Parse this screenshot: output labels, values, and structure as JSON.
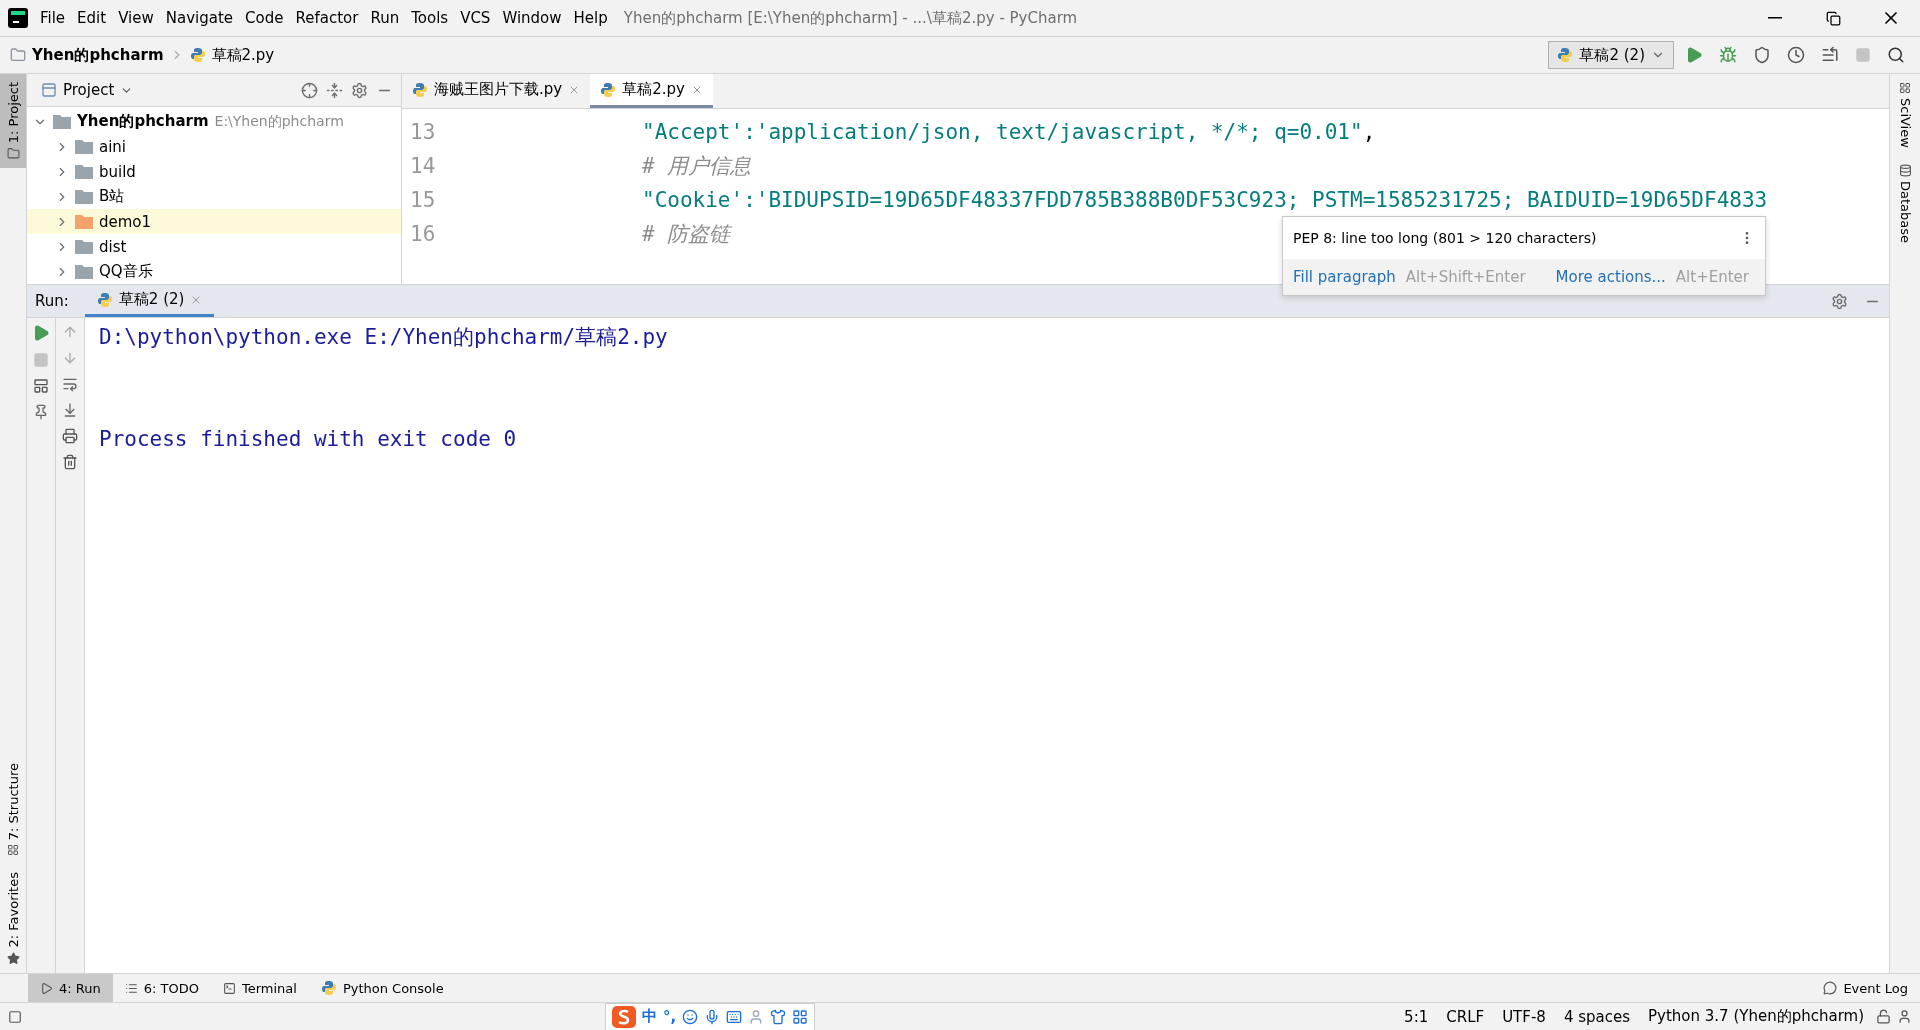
{
  "window": {
    "title": "Yhen的phcharm [E:\\Yhen的phcharm] - ...\\草稿2.py - PyCharm"
  },
  "menu": [
    "File",
    "Edit",
    "View",
    "Navigate",
    "Code",
    "Refactor",
    "Run",
    "Tools",
    "VCS",
    "Window",
    "Help"
  ],
  "breadcrumb": [
    "Yhen的phcharm",
    "草稿2.py"
  ],
  "run_config": {
    "label": "草稿2 (2)"
  },
  "left_stripe": [
    "1: Project",
    "7: Structure",
    "2: Favorites"
  ],
  "right_stripe": [
    "SciView",
    "Database"
  ],
  "project": {
    "title": "Project",
    "tree": [
      {
        "name": "Yhen的phcharm",
        "path": "E:\\Yhen的phcharm",
        "expanded": true,
        "selected": false,
        "color": "#9aa4ad",
        "children": [
          {
            "name": "aini",
            "expanded": false,
            "selected": false,
            "color": "#9aa4ad"
          },
          {
            "name": "build",
            "expanded": false,
            "selected": false,
            "color": "#9aa4ad"
          },
          {
            "name": "B站",
            "expanded": false,
            "selected": false,
            "color": "#9aa4ad"
          },
          {
            "name": "demo1",
            "expanded": false,
            "selected": true,
            "color": "#f4a26b"
          },
          {
            "name": "dist",
            "expanded": false,
            "selected": false,
            "color": "#9aa4ad"
          },
          {
            "name": "QQ音乐",
            "expanded": false,
            "selected": false,
            "color": "#9aa4ad"
          }
        ]
      }
    ]
  },
  "editor": {
    "tabs": [
      {
        "label": "海贼王图片下载.py",
        "selected": false
      },
      {
        "label": "草稿2.py",
        "selected": true
      }
    ],
    "lines": [
      {
        "number": "13",
        "parts": [
          {
            "kind": "string",
            "text": "\"Accept':'application/json, text/javascript, */*; q=0.01\""
          },
          {
            "kind": "plain",
            "text": ","
          }
        ]
      },
      {
        "number": "14",
        "parts": [
          {
            "kind": "comment",
            "text": "# 用户信息"
          }
        ]
      },
      {
        "number": "15",
        "parts": [
          {
            "kind": "string",
            "text": "\"Cookie':'BIDUPSID=19D65DF48337FDD785B388B0DF53C923; PSTM=1585231725; BAIDUID=19D65DF4833"
          }
        ]
      },
      {
        "number": "16",
        "parts": [
          {
            "kind": "comment",
            "text": "# 防盗链"
          }
        ]
      }
    ]
  },
  "tooltip": {
    "message": "PEP 8: line too long (801 > 120 characters)",
    "actions": [
      {
        "label": "Fill paragraph",
        "shortcut": "Alt+Shift+Enter"
      },
      {
        "label": "More actions...",
        "shortcut": "Alt+Enter"
      }
    ]
  },
  "run": {
    "label": "Run:",
    "tabs": [
      {
        "label": "草稿2 (2)",
        "selected": true
      }
    ],
    "output": [
      {
        "kind": "command",
        "text": "D:\\python\\python.exe E:/Yhen的phcharm/草稿2.py"
      },
      {
        "kind": "exit",
        "text": "Process finished with exit code 0"
      }
    ]
  },
  "tool_tabs": [
    {
      "label": "4: Run",
      "kind": "run",
      "selected": true
    },
    {
      "label": "6: TODO",
      "kind": "todo",
      "selected": false
    },
    {
      "label": "Terminal",
      "kind": "terminal",
      "selected": false
    },
    {
      "label": "Python Console",
      "kind": "console",
      "selected": false
    }
  ],
  "event_log": "Event Log",
  "ime": [
    "中",
    "°,"
  ],
  "status": [
    "5:1",
    "CRLF",
    "UTF-8",
    "4 spaces",
    "Python 3.7 (Yhen的phcharm)"
  ]
}
